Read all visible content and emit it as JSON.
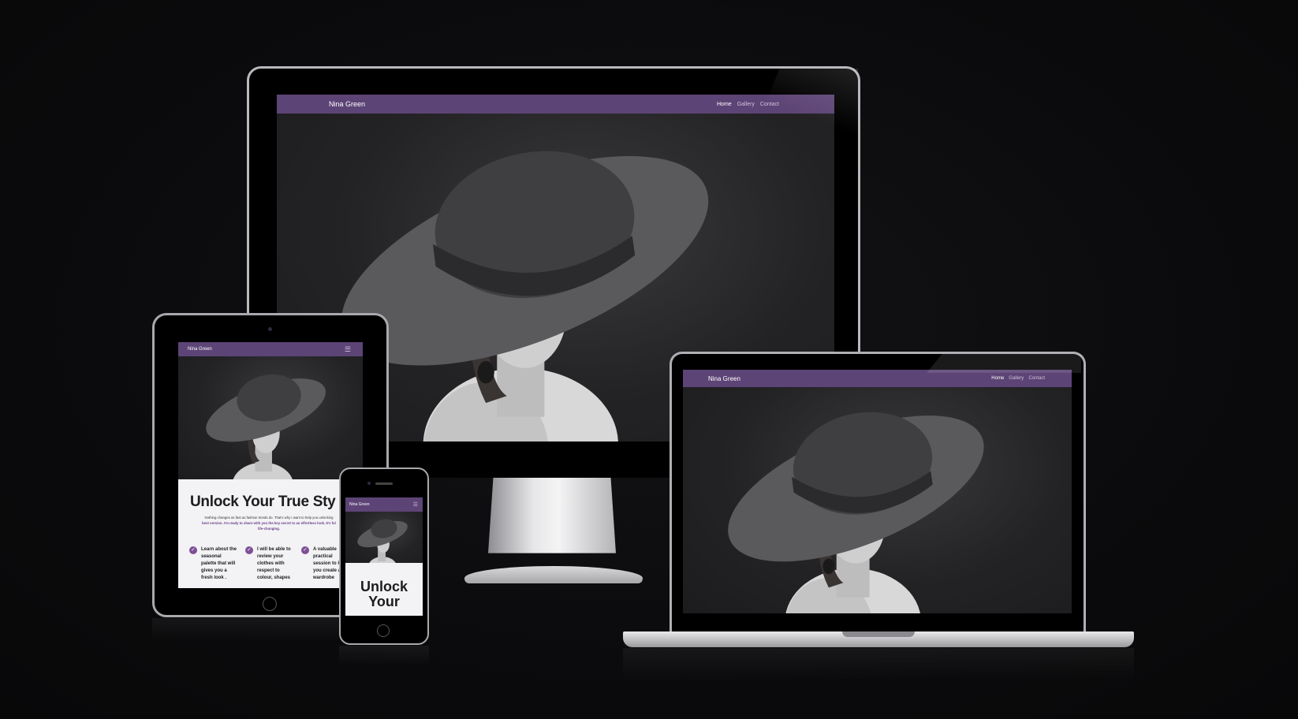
{
  "site": {
    "brand": "Nina Green",
    "nav": [
      "Home",
      "Gallery",
      "Contact"
    ],
    "menu_icon": "hamburger-icon",
    "hero_title": "Unlock Your True Sty",
    "hero_title_mobile": "Unlock Your",
    "hero_text_lines": [
      "Nothing changes as fast as fashion trends do. That's why I want to help you unlocking",
      "best version. I'm ready to share with you the key secret to an effortless look. It's ful",
      "life-changing."
    ],
    "hero_highlights": [
      "best version.",
      "life-changing."
    ],
    "features": [
      "Learn about the seasonal palette that will gives you a fresh look .",
      "I will be able to review your clothes with respect to colour, shapes",
      "A valuable practical session to help you create a wardrobe"
    ],
    "check_icon": "check-icon"
  },
  "colors": {
    "nav_purple": "#5d4476",
    "accent_purple": "#7d4f96",
    "background": "#0b0b0d"
  }
}
